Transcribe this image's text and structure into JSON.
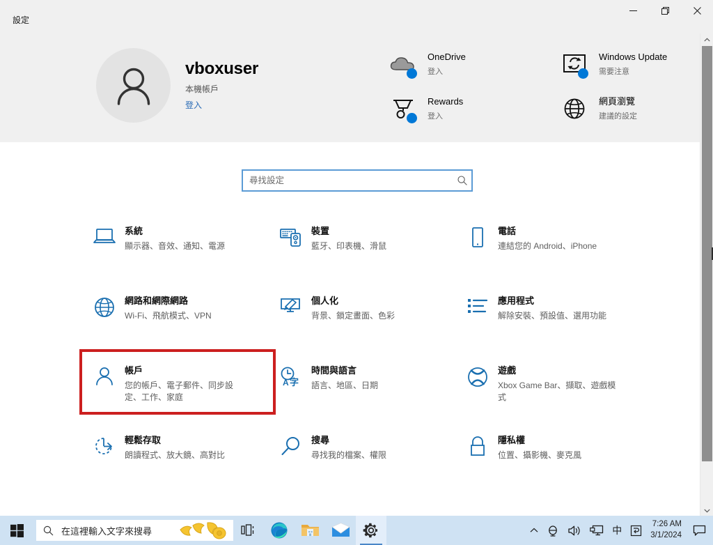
{
  "window": {
    "title": "設定",
    "minimize_label": "最小化",
    "restore_label": "還原",
    "close_label": "關閉"
  },
  "account": {
    "name": "vboxuser",
    "type": "本機帳戶",
    "signin_link": "登入",
    "avatar_icon": "person-icon"
  },
  "quicklinks": [
    {
      "title": "OneDrive",
      "sub": "登入",
      "icon": "onedrive-cloud-icon"
    },
    {
      "title": "Windows Update",
      "sub": "需要注意",
      "icon": "windows-update-icon"
    },
    {
      "title": "Rewards",
      "sub": "登入",
      "icon": "rewards-trophy-icon"
    },
    {
      "title": "網頁瀏覽",
      "sub": "建議的設定",
      "icon": "globe-icon"
    }
  ],
  "search": {
    "placeholder": "尋找設定",
    "value": "",
    "icon": "search-icon"
  },
  "tiles": [
    {
      "title": "系統",
      "sub": "顯示器、音效、通知、電源",
      "icon": "laptop-icon",
      "highlight": false
    },
    {
      "title": "裝置",
      "sub": "藍牙、印表機、滑鼠",
      "icon": "devices-keyboard-icon",
      "highlight": false
    },
    {
      "title": "電話",
      "sub": "連結您的 Android、iPhone",
      "icon": "phone-icon",
      "highlight": false
    },
    {
      "title": "網路和網際網路",
      "sub": "Wi-Fi、飛航模式、VPN",
      "icon": "network-globe-icon",
      "highlight": false
    },
    {
      "title": "個人化",
      "sub": "背景、鎖定畫面、色彩",
      "icon": "personalization-brush-icon",
      "highlight": false
    },
    {
      "title": "應用程式",
      "sub": "解除安裝、預設值、選用功能",
      "icon": "apps-list-icon",
      "highlight": false
    },
    {
      "title": "帳戶",
      "sub": "您的帳戶、電子郵件、同步設定、工作、家庭",
      "icon": "account-person-icon",
      "highlight": true
    },
    {
      "title": "時間與語言",
      "sub": "語言、地區、日期",
      "icon": "time-language-icon",
      "highlight": false
    },
    {
      "title": "遊戲",
      "sub": "Xbox Game Bar、擷取、遊戲模式",
      "icon": "xbox-icon",
      "highlight": false
    },
    {
      "title": "輕鬆存取",
      "sub": "朗讀程式、放大鏡、高對比",
      "icon": "ease-of-access-icon",
      "highlight": false
    },
    {
      "title": "搜尋",
      "sub": "尋找我的檔案、權限",
      "icon": "search-magnifier-icon",
      "highlight": false
    },
    {
      "title": "隱私權",
      "sub": "位置、攝影機、麥克風",
      "icon": "privacy-lock-icon",
      "highlight": false
    }
  ],
  "taskbar": {
    "start_label": "開始",
    "search_placeholder": "在這裡輸入文字來搜尋",
    "taskview_label": "工作檢視",
    "apps": [
      {
        "name": "edge-icon",
        "label": "Microsoft Edge",
        "active": false
      },
      {
        "name": "file-explorer-icon",
        "label": "檔案總管",
        "active": false
      },
      {
        "name": "mail-icon",
        "label": "郵件",
        "active": false
      },
      {
        "name": "settings-gear-icon",
        "label": "設定",
        "active": true
      }
    ],
    "tray": {
      "overflow": "顯示隱藏的圖示",
      "network_label": "網路",
      "volume_label": "音量",
      "display_label": "顯示",
      "ime": "中",
      "ime_mode": "ㄅ"
    },
    "clock": {
      "time": "7:26 AM",
      "date": "3/1/2024"
    },
    "action_center_label": "重要訊息中心"
  },
  "colors": {
    "accent": "#0078d7",
    "highlight_red": "#cc1f1f",
    "header_bg": "#f0f0f0",
    "taskbar_bg": "#cfe2f3",
    "icon_blue": "#1a6fb0"
  }
}
